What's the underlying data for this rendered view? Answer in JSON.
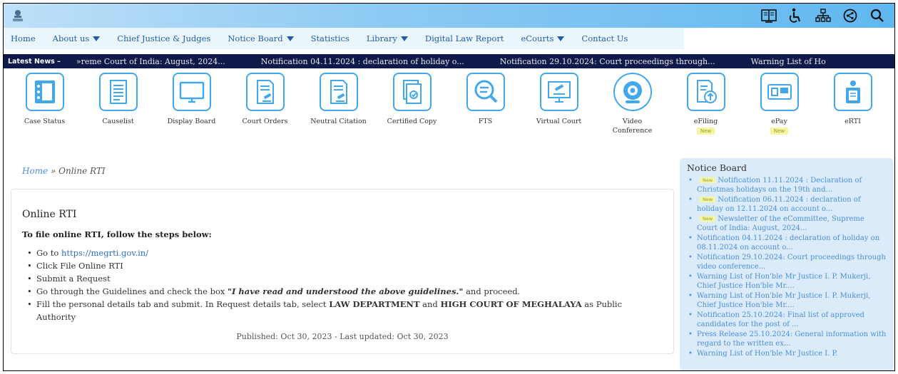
{
  "header": {
    "icons": [
      "sitemap-book-icon",
      "accessibility-icon",
      "sitemap-icon",
      "share-icon",
      "search-icon"
    ]
  },
  "nav": {
    "items": [
      {
        "label": "Home",
        "dropdown": false
      },
      {
        "label": "About us",
        "dropdown": true
      },
      {
        "label": "Chief Justice & Judges",
        "dropdown": false
      },
      {
        "label": "Notice Board",
        "dropdown": true
      },
      {
        "label": "Statistics",
        "dropdown": false
      },
      {
        "label": "Library",
        "dropdown": true
      },
      {
        "label": "Digital Law Report",
        "dropdown": false
      },
      {
        "label": "eCourts",
        "dropdown": true
      },
      {
        "label": "Contact Us",
        "dropdown": false
      }
    ]
  },
  "ticker": {
    "label": "Latest News –",
    "items": [
      "»reme Court of India: August, 2024...",
      "Notification 04.11.2024 : declaration of holiday o...",
      "Notification 29.10.2024: Court proceedings through...",
      "Warning List of Ho"
    ]
  },
  "services": [
    {
      "label": "Case Status",
      "icon": "case-status-icon"
    },
    {
      "label": "Causelist",
      "icon": "causelist-icon"
    },
    {
      "label": "Display Board",
      "icon": "display-board-icon"
    },
    {
      "label": "Court Orders",
      "icon": "court-orders-icon"
    },
    {
      "label": "Neutral Citation",
      "icon": "neutral-citation-icon"
    },
    {
      "label": "Certified Copy",
      "icon": "certified-copy-icon"
    },
    {
      "label": "FTS",
      "icon": "fts-icon"
    },
    {
      "label": "Virtual Court",
      "icon": "virtual-court-icon"
    },
    {
      "label": "Video Conference",
      "icon": "webcam-icon"
    },
    {
      "label": "eFiling",
      "icon": "efiling-icon",
      "badge": "New"
    },
    {
      "label": "ePay",
      "icon": "epay-icon",
      "badge": "New"
    },
    {
      "label": "eRTI",
      "icon": "erti-icon"
    }
  ],
  "breadcrumb": {
    "home": "Home",
    "separator": " » ",
    "current": "Online RTI"
  },
  "content": {
    "title": "Online RTI",
    "intro": "To file online RTI, follow the steps below:",
    "step1_prefix": "Go to ",
    "step1_link": "https://megrti.gov.in/",
    "step2": "Click File Online RTI",
    "step3": "Submit a Request",
    "step4_prefix": "Go through the Guidelines and check the box ",
    "step4_emphasis": "\"I have read and understood the above guidelines.\"",
    "step4_suffix": " and proceed.",
    "step5_a": "Fill the personal details tab and submit. In Request details tab, select ",
    "step5_b": "LAW DEPARTMENT",
    "step5_c": " and ",
    "step5_d": "HIGH COURT OF MEGHALAYA",
    "step5_e": " as Public Authority",
    "published": "Published: Oct 30, 2023 - Last updated: Oct 30, 2023"
  },
  "notice_board": {
    "title": "Notice Board",
    "items": [
      {
        "text": "Notification 11.11.2024 : Declaration of Christmas holidays on the 19th and...",
        "new": true
      },
      {
        "text": "Notification 06.11.2024 : declaration of holiday on 12.11.2024 on account o...",
        "new": true
      },
      {
        "text": "Newsletter of the eCommittee, Supreme Court of India: August, 2024...",
        "new": true
      },
      {
        "text": "Notification 04.11.2024 : declaration of holiday on 08.11.2024 on account o...",
        "new": false
      },
      {
        "text": "Notification 29.10.2024: Court proceedings through video conference...",
        "new": false
      },
      {
        "text": "Warning List of Hon'ble Mr Justice I. P. Mukerji, Chief Justice Hon'ble Mr....",
        "new": false
      },
      {
        "text": "Warning List of Hon'ble Mr Justice I. P. Mukerji, Chief Justice Hon'ble Mr....",
        "new": false
      },
      {
        "text": "Notification 25.10.2024: Final list of approved candidates for the post of ...",
        "new": false
      },
      {
        "text": "Press Release 25.10.2024: General information with regard to the written ex...",
        "new": false
      },
      {
        "text": "Warning List of Hon'ble Mr Justice I. P.",
        "new": false
      }
    ],
    "new_label": "New"
  }
}
